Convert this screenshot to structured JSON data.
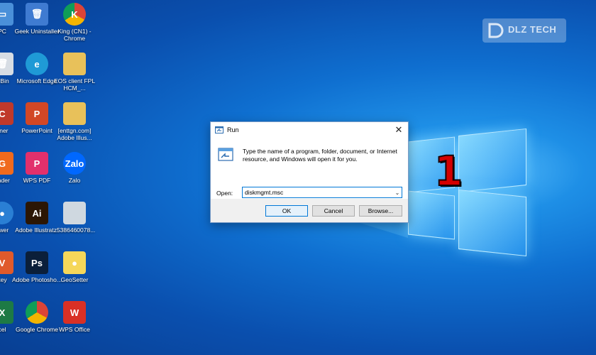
{
  "desktop": {
    "icons": [
      {
        "label": "PC",
        "name": "this-pc-icon",
        "color": "#4a90d9",
        "glyph": "▭"
      },
      {
        "label": "Geek Uninstaller",
        "name": "geek-uninstaller-icon",
        "color": "#3f7bd1",
        "glyph": "🗑"
      },
      {
        "label": "King (CN1) - Chrome",
        "name": "chrome-profile-icon",
        "color": "#db4437",
        "glyph": "K"
      },
      {
        "label": "e Bin",
        "name": "recycle-bin-icon",
        "color": "#d7dde4",
        "glyph": "🗑"
      },
      {
        "label": "Microsoft Edge",
        "name": "edge-icon",
        "color": "#1f9ad6",
        "glyph": "e"
      },
      {
        "label": "EOS client FPL HCM_...",
        "name": "folder-icon",
        "color": "#e8c15a",
        "glyph": ""
      },
      {
        "label": "aner",
        "name": "ccleaner-icon",
        "color": "#c0392b",
        "glyph": "C"
      },
      {
        "label": "PowerPoint",
        "name": "powerpoint-icon",
        "color": "#d24726",
        "glyph": "P"
      },
      {
        "label": "[enttgn.com] Adobe Illus...",
        "name": "folder-icon",
        "color": "#e8c15a",
        "glyph": ""
      },
      {
        "label": "eader",
        "name": "foxit-reader-icon",
        "color": "#f06a1d",
        "glyph": "G"
      },
      {
        "label": "WPS PDF",
        "name": "wps-pdf-icon",
        "color": "#e2306c",
        "glyph": "P"
      },
      {
        "label": "Zalo",
        "name": "zalo-icon",
        "color": "#0068ff",
        "glyph": "Zalo"
      },
      {
        "label": "ewer",
        "name": "viewer-icon",
        "color": "#2a7fd4",
        "glyph": "●"
      },
      {
        "label": "Adobe Illustrat...",
        "name": "illustrator-icon",
        "color": "#2b1604",
        "glyph": "Ai"
      },
      {
        "label": "z5386460078...",
        "name": "image-file-icon",
        "color": "#cfd8e0",
        "glyph": ""
      },
      {
        "label": "key",
        "name": "unikey-icon",
        "color": "#e05a2b",
        "glyph": "V"
      },
      {
        "label": "Adobe Photosho...",
        "name": "photoshop-icon",
        "color": "#0b1f3a",
        "glyph": "Ps"
      },
      {
        "label": "GeoSetter",
        "name": "geosetter-icon",
        "color": "#f5d75a",
        "glyph": "●"
      },
      {
        "label": "cel",
        "name": "excel-icon",
        "color": "#1d7a45",
        "glyph": "X"
      },
      {
        "label": "Google Chrome",
        "name": "google-chrome-icon",
        "color": "#db4437",
        "glyph": ""
      },
      {
        "label": "WPS Office",
        "name": "wps-office-icon",
        "color": "#d93025",
        "glyph": "W"
      }
    ]
  },
  "watermark": {
    "text": "DLZ TECH"
  },
  "annotation": {
    "step_number": "1"
  },
  "run_dialog": {
    "title": "Run",
    "close_glyph": "✕",
    "description": "Type the name of a program, folder, document, or Internet resource, and Windows will open it for you.",
    "open_label": "Open:",
    "open_value": "diskmgmt.msc",
    "dropdown_glyph": "⌄",
    "buttons": {
      "ok": "OK",
      "cancel": "Cancel",
      "browse": "Browse..."
    }
  },
  "colors": {
    "accent": "#0078d7",
    "annotation_red": "#d40000"
  }
}
